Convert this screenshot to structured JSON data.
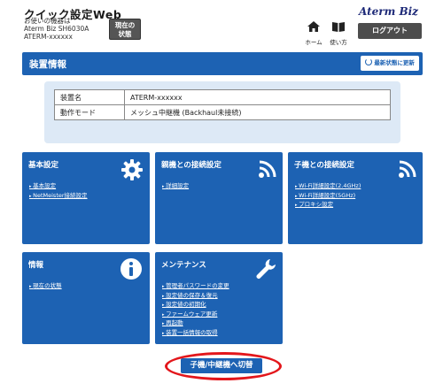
{
  "header": {
    "app_title": "クイック設定Web",
    "device_lines": [
      "お使いの機器は",
      "Aterm Biz SH6030A",
      "ATERM-xxxxxx"
    ],
    "status_button": [
      "現在の",
      "状態"
    ],
    "brand": "Aterm Biz",
    "home_label": "ホーム",
    "help_label": "使い方",
    "logout_label": "ログアウト"
  },
  "device_info": {
    "title": "装置情報",
    "refresh_label": "最新状態に更新",
    "rows": [
      {
        "key": "装置名",
        "value": "ATERM-xxxxxx"
      },
      {
        "key": "動作モード",
        "value": "メッシュ中継機 (Backhaul未接続)"
      }
    ]
  },
  "cards": {
    "basic": {
      "title": "基本設定",
      "links": [
        "基本設定",
        "NetMeister接続設定"
      ]
    },
    "parent": {
      "title": "親機との接続設定",
      "links": [
        "詳細設定"
      ]
    },
    "child": {
      "title": "子機との接続設定",
      "links": [
        "Wi-Fi詳細設定(2.4GHz)",
        "Wi-Fi詳細設定(5GHz)",
        "プロキシ設定"
      ]
    },
    "info": {
      "title": "情報",
      "links": [
        "現在の状態"
      ]
    },
    "maint": {
      "title": "メンテナンス",
      "links": [
        "管理者パスワードの変更",
        "設定値の保存＆復元",
        "設定値の初期化",
        "ファームウェア更新",
        "再起動",
        "装置一括情報の取得"
      ]
    }
  },
  "switch_button": "子機/中継機へ切替",
  "colors": {
    "accent": "#1d62b3",
    "highlight": "#e3161b"
  }
}
